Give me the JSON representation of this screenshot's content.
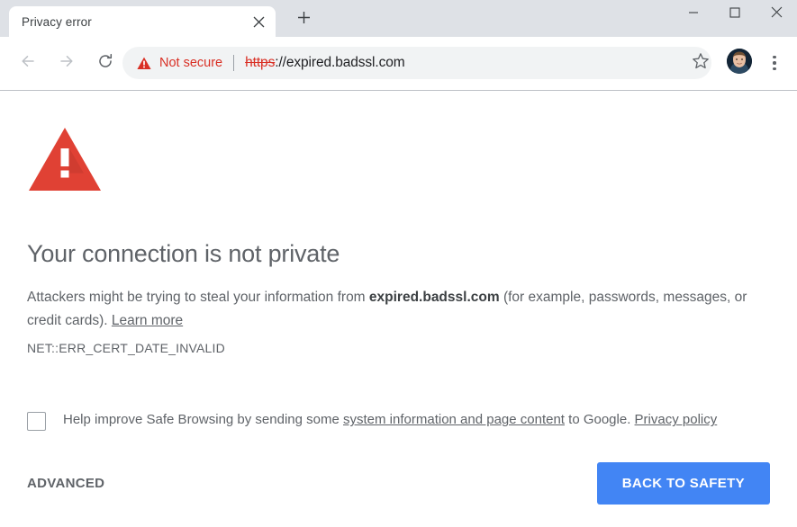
{
  "window": {
    "minimize_label": "Minimize",
    "maximize_label": "Maximize",
    "close_label": "Close"
  },
  "tabs": [
    {
      "title": "Privacy error",
      "active": true,
      "close_label": "Close tab"
    }
  ],
  "newtab_label": "New Tab",
  "toolbar": {
    "back_label": "Back",
    "forward_label": "Forward",
    "reload_label": "Reload",
    "bookmark_label": "Bookmark this page",
    "profile_label": "Profile",
    "menu_label": "Customize and control Google Chrome",
    "security_status": "Not secure",
    "url_scheme": "https",
    "url_rest": "://expired.badssl.com",
    "url_full": "https://expired.badssl.com"
  },
  "interstitial": {
    "icon": "warning-triangle-icon",
    "title": "Your connection is not private",
    "body_part1": "Attackers might be trying to steal your information from ",
    "body_host": "expired.badssl.com",
    "body_part2": " (for example, passwords, messages, or credit cards). ",
    "learn_more": "Learn more",
    "error_code": "NET::ERR_CERT_DATE_INVALID",
    "optin": {
      "checked": false,
      "text_part1": "Help improve Safe Browsing by sending some ",
      "link1": "system information and page content",
      "text_part2": " to Google. ",
      "link2": "Privacy policy"
    },
    "advanced_label": "ADVANCED",
    "back_to_safety_label": "BACK TO SAFETY"
  },
  "colors": {
    "danger": "#d93025",
    "triangle": "#e04134",
    "primary_button": "#4285f4",
    "text_muted": "#5f6368",
    "tabstrip": "#dee1e6",
    "omnibox": "#f1f3f4"
  }
}
